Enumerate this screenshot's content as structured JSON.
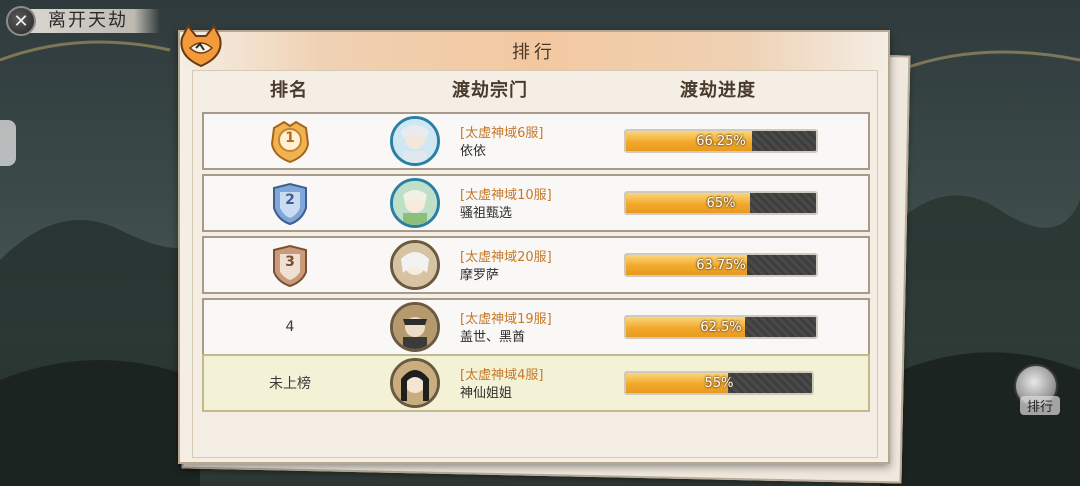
{
  "exit_button": {
    "label": "离开天劫",
    "icon": "close-icon"
  },
  "side_button": {
    "label": "排行",
    "icon": "ranking-icon"
  },
  "panel": {
    "title": "排行",
    "columns": {
      "rank": "排名",
      "sect": "渡劫宗门",
      "progress": "渡劫进度"
    }
  },
  "rows": [
    {
      "rank": "1",
      "rank_style": "gold-medal",
      "server": "[太虚神域6服]",
      "player": "依依",
      "progress_text": "66.25%",
      "progress": 0.6625
    },
    {
      "rank": "2",
      "rank_style": "silver-medal",
      "server": "[太虚神域10服]",
      "player": "骚祖甄选",
      "progress_text": "65%",
      "progress": 0.65
    },
    {
      "rank": "3",
      "rank_style": "bronze-medal",
      "server": "[太虚神域20服]",
      "player": "摩罗萨",
      "progress_text": "63.75%",
      "progress": 0.6375
    },
    {
      "rank": "4",
      "rank_style": "plain",
      "server": "[太虚神域19服]",
      "player": "盖世、黑酋",
      "progress_text": "62.5%",
      "progress": 0.625
    },
    {
      "rank": "未上榜",
      "rank_style": "plain",
      "server": "[太虚神域4服]",
      "player": "神仙姐姐",
      "progress_text": "55%",
      "progress": 0.55
    }
  ],
  "colors": {
    "server_text": "#c6782a",
    "progress_fill": "#f2a92b",
    "self_row": "#f3f1d6"
  }
}
